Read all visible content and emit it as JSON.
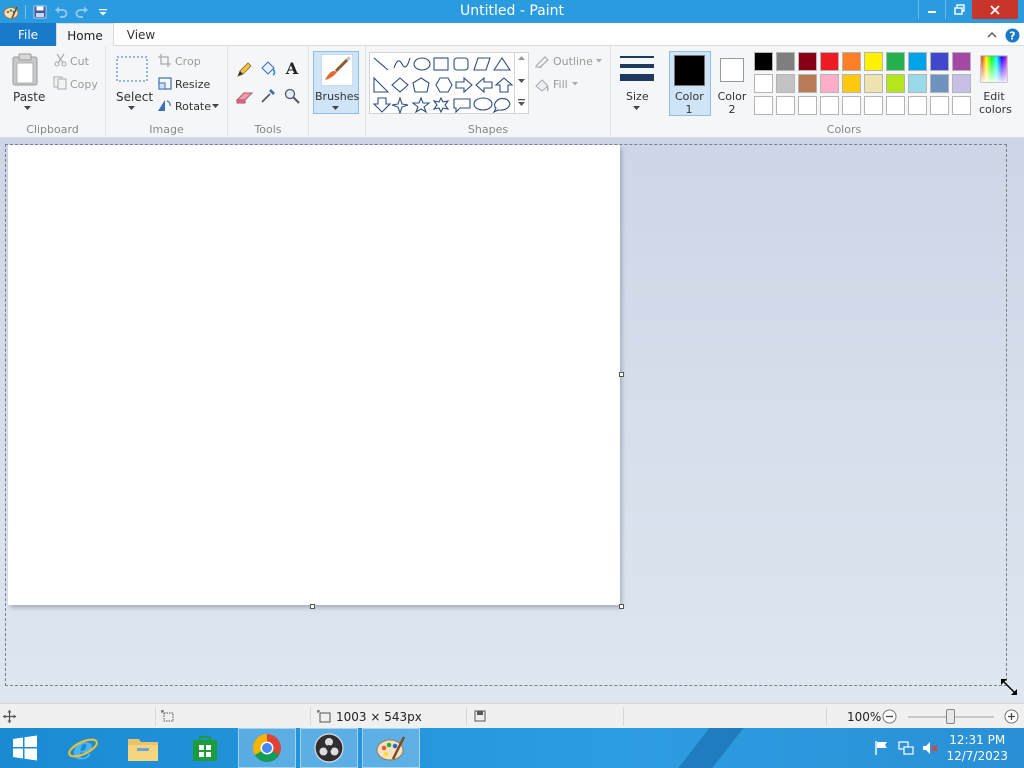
{
  "window": {
    "title": "Untitled - Paint"
  },
  "tabs": {
    "file": "File",
    "home": "Home",
    "view": "View"
  },
  "clipboard": {
    "paste": "Paste",
    "cut": "Cut",
    "copy": "Copy",
    "group": "Clipboard"
  },
  "image": {
    "select": "Select",
    "crop": "Crop",
    "resize": "Resize",
    "rotate": "Rotate",
    "group": "Image"
  },
  "tools": {
    "group": "Tools"
  },
  "brushes": {
    "label": "Brushes"
  },
  "shapes": {
    "outline": "Outline",
    "fill": "Fill",
    "group": "Shapes"
  },
  "size": {
    "label": "Size"
  },
  "colors": {
    "color1_line1": "Color",
    "color1_line2": "1",
    "color2_line1": "Color",
    "color2_line2": "2",
    "edit_line1": "Edit",
    "edit_line2": "colors",
    "group": "Colors",
    "color1_value": "#000000",
    "color2_value": "#ffffff",
    "palette": [
      [
        "#000000",
        "#7f7f7f",
        "#880015",
        "#ed1c24",
        "#ff7f27",
        "#fff200",
        "#22b14c",
        "#00a2e8",
        "#3f48cc",
        "#a349a4"
      ],
      [
        "#ffffff",
        "#c3c3c3",
        "#b97a57",
        "#ffaec9",
        "#ffc90e",
        "#efe4b0",
        "#b5e61d",
        "#99d9ea",
        "#7092be",
        "#c8bfe7"
      ],
      [
        "#ffffff",
        "#ffffff",
        "#ffffff",
        "#ffffff",
        "#ffffff",
        "#ffffff",
        "#ffffff",
        "#ffffff",
        "#ffffff",
        "#ffffff"
      ]
    ]
  },
  "status": {
    "dimensions": "1003 × 543px",
    "zoom": "100%"
  },
  "clock": {
    "time": "12:31 PM",
    "date": "12/7/2023"
  }
}
